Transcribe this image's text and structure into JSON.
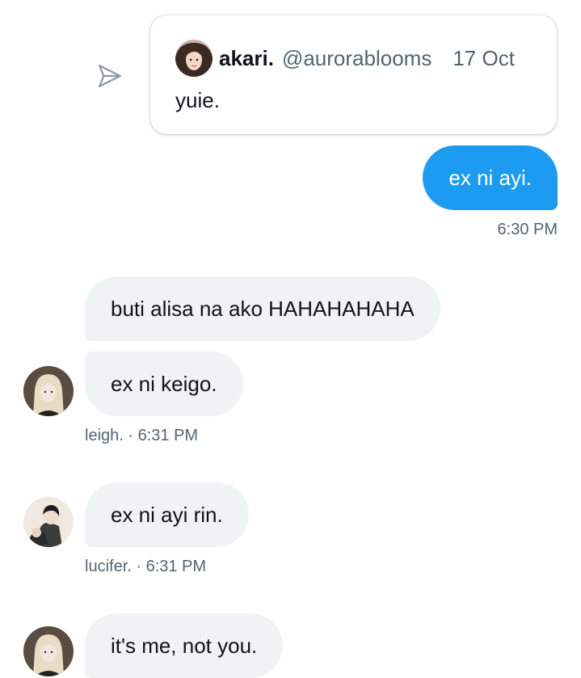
{
  "shared_tweet": {
    "author_name": "akari.",
    "author_handle": "@aurorablooms",
    "date": "17 Oct",
    "text": "yuie."
  },
  "sent_message": {
    "text": "ex ni ayi.",
    "time": "6:30 PM"
  },
  "received": [
    {
      "messages": [
        "buti alisa na ako HAHAHAHAHA",
        "ex ni keigo."
      ],
      "meta": "leigh. · 6:31 PM"
    },
    {
      "messages": [
        "ex ni ayi rin."
      ],
      "meta": "lucifer. · 6:31 PM"
    },
    {
      "messages": [
        "it's me, not you."
      ]
    }
  ],
  "colors": {
    "accent": "#1d9bf0",
    "bubble_received": "#eff3f4",
    "secondary_text": "#536471"
  }
}
